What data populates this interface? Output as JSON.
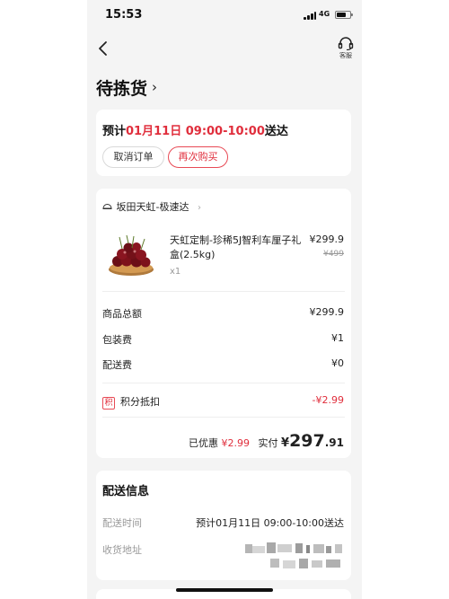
{
  "status_bar": {
    "time": "15:53",
    "network": "4G"
  },
  "header": {
    "service_label": "客服"
  },
  "page": {
    "title": "待拣货"
  },
  "delivery_eta": {
    "prefix": "预计",
    "date_time": "01月11日 09:00-10:00",
    "suffix": "送达"
  },
  "actions": {
    "cancel_label": "取消订单",
    "rebuy_label": "再次购买"
  },
  "store": {
    "name": "坂田天虹-极速达"
  },
  "product": {
    "name": "天虹定制-珍稀5J智利车厘子礼盒(2.5kg)",
    "qty": "x1",
    "price": "¥299.9",
    "original_price": "¥499"
  },
  "summary": {
    "rows": [
      {
        "label": "商品总额",
        "value": "¥299.9"
      },
      {
        "label": "包装费",
        "value": "¥1"
      },
      {
        "label": "配送费",
        "value": "¥0"
      }
    ],
    "points": {
      "badge": "积",
      "label": "积分抵扣",
      "value": "-¥2.99"
    },
    "discount_label": "已优惠",
    "discount_value": "¥2.99",
    "paid_label": "实付",
    "paid_currency": "¥",
    "paid_integer": "297",
    "paid_decimal": ".91"
  },
  "delivery_info": {
    "title": "配送信息",
    "time_label": "配送时间",
    "time_value": "预计01月11日 09:00-10:00送达",
    "address_label": "收货地址"
  },
  "colors": {
    "accent": "#e02e3c",
    "background": "#f4f4f4",
    "card": "#ffffff"
  }
}
